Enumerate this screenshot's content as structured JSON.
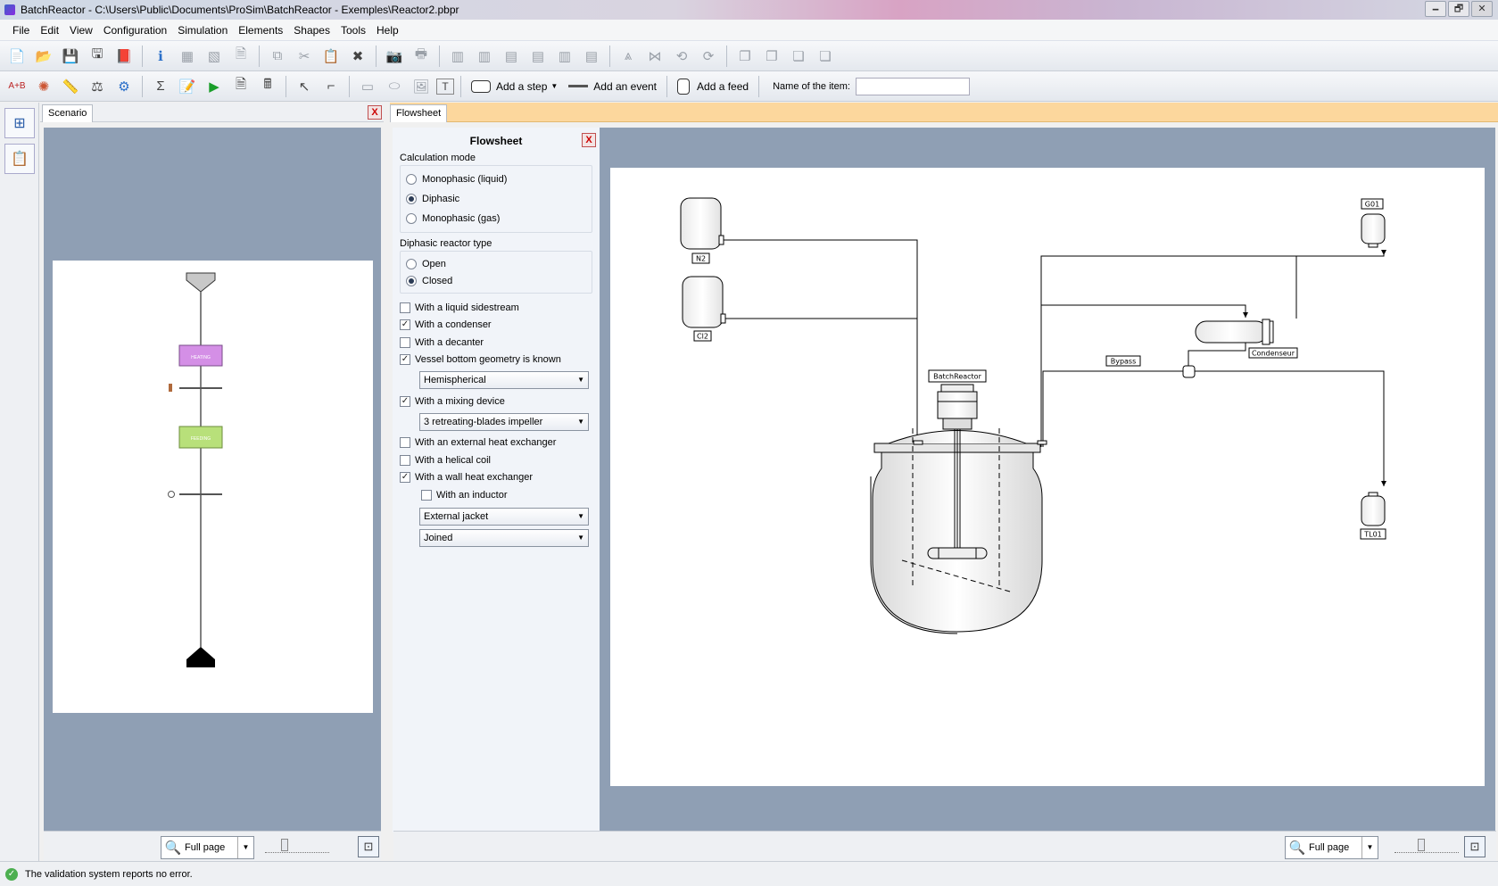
{
  "window": {
    "title": "BatchReactor - C:\\Users\\Public\\Documents\\ProSim\\BatchReactor - Exemples\\Reactor2.pbpr",
    "min": "🗕",
    "max": "🗗",
    "close": "✕"
  },
  "menu": [
    "File",
    "Edit",
    "View",
    "Configuration",
    "Simulation",
    "Elements",
    "Shapes",
    "Tools",
    "Help"
  ],
  "toolbar2": {
    "add_step": "Add a step",
    "add_event": "Add an event",
    "add_feed": "Add a feed",
    "name_label": "Name of the item:",
    "name_value": ""
  },
  "scenario": {
    "tab": "Scenario",
    "close": "X",
    "steps": [
      "HEATING",
      "FEEDING"
    ],
    "zoom": "Full page"
  },
  "flowsheet": {
    "tab": "Flowsheet",
    "panel_title": "Flowsheet",
    "close": "X",
    "calc_mode_title": "Calculation mode",
    "calc_modes": [
      {
        "label": "Monophasic (liquid)",
        "checked": false
      },
      {
        "label": "Diphasic",
        "checked": true
      },
      {
        "label": "Monophasic (gas)",
        "checked": false
      }
    ],
    "reactor_type_title": "Diphasic reactor type",
    "reactor_types": [
      {
        "label": "Open",
        "checked": false
      },
      {
        "label": "Closed",
        "checked": true
      }
    ],
    "options": {
      "liquid_sidestream": {
        "label": "With a liquid sidestream",
        "checked": false
      },
      "condenser": {
        "label": "With a condenser",
        "checked": true
      },
      "decanter": {
        "label": "With a decanter",
        "checked": false
      },
      "bottom_geometry": {
        "label": "Vessel bottom geometry is known",
        "checked": true
      },
      "bottom_geometry_value": "Hemispherical",
      "mixing_device": {
        "label": "With a mixing device",
        "checked": true
      },
      "mixing_device_value": "3 retreating-blades impeller",
      "ext_heat_exchanger": {
        "label": "With an external heat exchanger",
        "checked": false
      },
      "helical_coil": {
        "label": "With a helical coil",
        "checked": false
      },
      "wall_heat_exchanger": {
        "label": "With a wall heat exchanger",
        "checked": true
      },
      "inductor": {
        "label": "With an inductor",
        "checked": false
      },
      "jacket_type": "External jacket",
      "jacket_mode": "Joined"
    },
    "diagram_labels": {
      "n2": "N2",
      "cl2": "Cl2",
      "g01": "G01",
      "tl01": "TL01",
      "reactor": "BatchReactor",
      "condenser": "Condenseur",
      "bypass": "Bypass"
    },
    "zoom": "Full page"
  },
  "status": {
    "message": "The validation system reports no error."
  },
  "colors": {
    "heating_step": "#d48fe6",
    "feeding_step": "#b8e07a",
    "canvas_bg": "#8f9fb4",
    "flowsheet_tab_bar": "#fcd79d"
  }
}
